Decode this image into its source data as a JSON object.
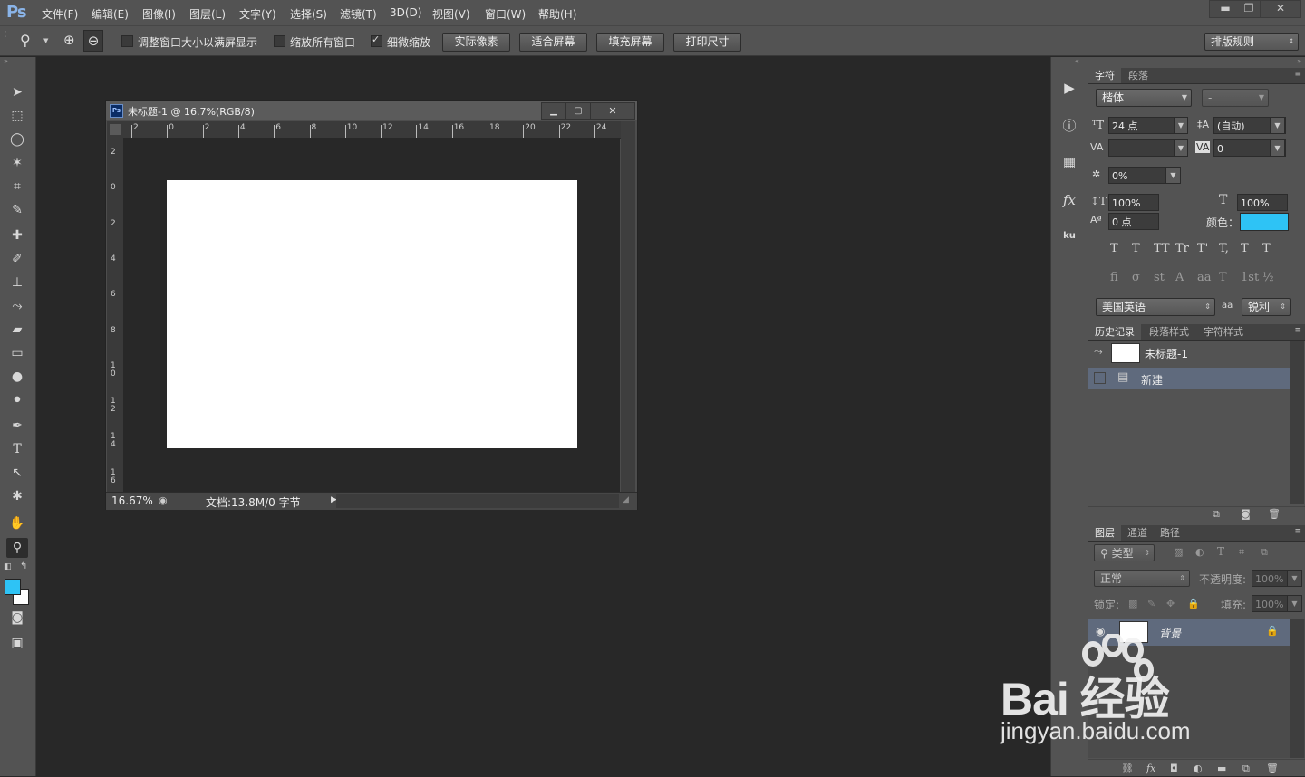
{
  "app": {
    "logo": "Ps"
  },
  "menu": [
    "文件(F)",
    "编辑(E)",
    "图像(I)",
    "图层(L)",
    "文字(Y)",
    "选择(S)",
    "滤镜(T)",
    "3D(D)",
    "视图(V)",
    "窗口(W)",
    "帮助(H)"
  ],
  "window_controls": {
    "minimize": "▬",
    "restore": "❐",
    "close": "✕"
  },
  "options": {
    "resize_windows": {
      "label": "调整窗口大小以满屏显示",
      "checked": false
    },
    "zoom_all": {
      "label": "缩放所有窗口",
      "checked": false
    },
    "scrubby_zoom": {
      "label": "细微缩放",
      "checked": true
    },
    "btn_actual": "实际像素",
    "btn_fit": "适合屏幕",
    "btn_fill": "填充屏幕",
    "btn_print": "打印尺寸",
    "workspace": "排版规则"
  },
  "document": {
    "title": "未标题-1 @ 16.7%(RGB/8)",
    "ruler_h": [
      "2",
      "0",
      "2",
      "4",
      "6",
      "8",
      "10",
      "12",
      "14",
      "16",
      "18",
      "20",
      "22",
      "24"
    ],
    "ruler_v": [
      "2",
      "0",
      "2",
      "4",
      "6",
      "8",
      "1\n0",
      "1\n2",
      "1\n4",
      "1\n6"
    ],
    "zoom": "16.67%",
    "doc_info": "文档:13.8M/0 字节"
  },
  "character_panel": {
    "tabs": [
      "字符",
      "段落"
    ],
    "font_family": "楷体",
    "font_style": "-",
    "font_size": "24 点",
    "leading": "(自动)",
    "kerning": "",
    "tracking": "0",
    "tsume": "0%",
    "vscale": "100%",
    "hscale": "100%",
    "baseline": "0 点",
    "color_label": "颜色：",
    "color": "#2ec3f5",
    "style_glyphs_1": [
      "T",
      "T",
      "TT",
      "Tr",
      "T'",
      "T,",
      "T",
      "T"
    ],
    "style_glyphs_2": [
      "fi",
      "σ",
      "st",
      "A",
      "aa",
      "T",
      "1st",
      "½"
    ],
    "language": "美国英语",
    "aa_label": "aa",
    "antialias": "锐利"
  },
  "history_panel": {
    "tabs": [
      "历史记录",
      "段落样式",
      "字符样式"
    ],
    "snapshot": "未标题-1",
    "states": [
      "新建"
    ]
  },
  "layers_panel": {
    "tabs": [
      "图层",
      "通道",
      "路径"
    ],
    "filter": "类型",
    "blend_mode": "正常",
    "opacity_label": "不透明度:",
    "opacity": "100%",
    "lock_label": "锁定:",
    "fill_label": "填充:",
    "fill": "100%",
    "layers": [
      {
        "name": "背景",
        "locked": true
      }
    ]
  },
  "watermark": {
    "brand": "Bai 经验",
    "url": "jingyan.baidu.com"
  }
}
